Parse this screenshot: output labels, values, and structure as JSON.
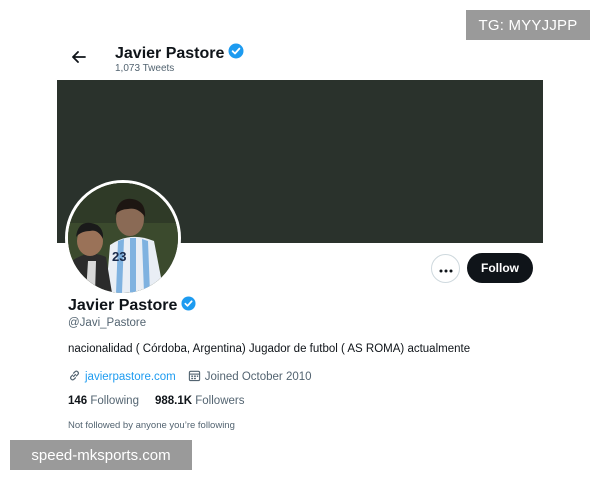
{
  "watermarks": {
    "top": "TG: MYYJJPP",
    "bottom": "speed-mksports.com"
  },
  "header": {
    "name": "Javier Pastore",
    "tweet_count": "1,073 Tweets"
  },
  "colors": {
    "banner": "#2a322c",
    "verified": "#1d9bf0",
    "link": "#1d9bf0",
    "follow_bg": "#0f1419"
  },
  "actions": {
    "more_icon": "more-horizontal-icon",
    "follow_label": "Follow"
  },
  "profile": {
    "name": "Javier Pastore",
    "handle": "@Javi_Pastore",
    "bio": "nacionalidad ( Córdoba, Argentina) Jugador de futbol ( AS ROMA) actualmente",
    "website": "javierpastore.com",
    "joined": "Joined October 2010",
    "following_count": "146",
    "following_label": "Following",
    "followers_count": "988.1K",
    "followers_label": "Followers",
    "notice": "Not followed by anyone you’re following"
  }
}
